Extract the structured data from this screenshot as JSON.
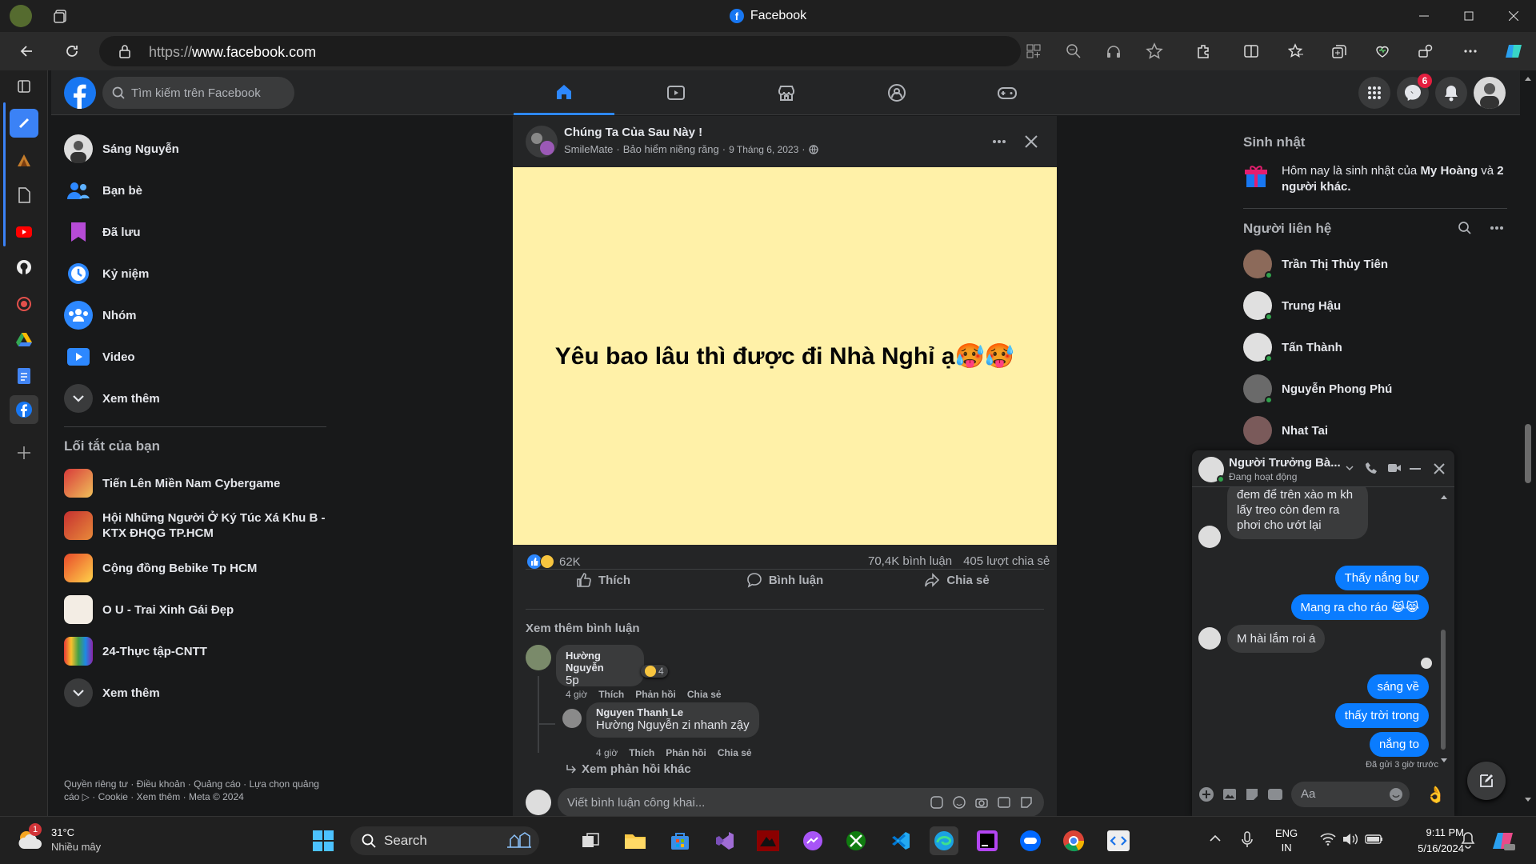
{
  "window": {
    "title": "Facebook"
  },
  "browser": {
    "url_scheme": "https://",
    "url_host": "www.facebook.com"
  },
  "fb": {
    "search_placeholder": "Tìm kiếm trên Facebook",
    "messenger_badge": "6"
  },
  "left_menu": {
    "items": [
      {
        "label": "Sáng Nguyễn",
        "icon": "avatar"
      },
      {
        "label": "Bạn bè",
        "icon": "friends-icon"
      },
      {
        "label": "Đã lưu",
        "icon": "bookmark-icon"
      },
      {
        "label": "Kỷ niệm",
        "icon": "clock-icon"
      },
      {
        "label": "Nhóm",
        "icon": "groups-icon"
      },
      {
        "label": "Video",
        "icon": "video-icon"
      },
      {
        "label": "Xem thêm",
        "icon": "chevron-down-icon"
      }
    ],
    "shortcuts_title": "Lối tắt của bạn",
    "shortcuts": [
      {
        "label": "Tiến Lên Miền Nam Cybergame"
      },
      {
        "label": "Hội Những Người Ở Ký Túc Xá Khu B - KTX ĐHQG TP.HCM"
      },
      {
        "label": "Cộng đồng Bebike Tp HCM"
      },
      {
        "label": "O U - Trai Xinh Gái Đẹp"
      },
      {
        "label": "24-Thực tập-CNTT"
      }
    ],
    "shortcuts_more": "Xem thêm",
    "footer": "Quyền riêng tư · Điều khoản · Quảng cáo · Lựa chọn quảng cáo ▷ · Cookie · Xem thêm · Meta © 2024"
  },
  "post": {
    "page_name": "Chúng Ta Của Sau Này !",
    "sub_author": "SmileMate",
    "sub_sponsor": "Bảo hiểm niềng răng",
    "date": "9 Tháng 6, 2023",
    "image_text": "Yêu bao lâu thì được đi Nhà Nghỉ ạ🥵🥵",
    "reactions_count": "62K",
    "comments_count": "70,4K bình luận",
    "shares_count": "405 lượt chia sẻ",
    "like_label": "Thích",
    "comment_label": "Bình luận",
    "share_label": "Chia sẻ",
    "more_comments": "Xem thêm bình luận",
    "comments": [
      {
        "author": "Hường Nguyễn",
        "text": "5p",
        "reaction_count": "4",
        "time": "4 giờ",
        "like": "Thích",
        "reply": "Phản hồi",
        "share": "Chia sẻ"
      },
      {
        "author": "Nguyen Thanh Le",
        "mention": "Hường Nguyễn",
        "text": " zi nhanh zậy",
        "time": "4 giờ",
        "like": "Thích",
        "reply": "Phản hồi",
        "share": "Chia sẻ"
      }
    ],
    "more_replies": "Xem phản hồi khác",
    "comment_placeholder": "Viết bình luận công khai..."
  },
  "right_panel": {
    "birthday_title": "Sinh nhật",
    "birthday_text_pre": "Hôm nay là sinh nhật của ",
    "birthday_name": "My Hoàng",
    "birthday_text_mid": " và ",
    "birthday_others": "2 người khác.",
    "contacts_title": "Người liên hệ",
    "contacts": [
      {
        "name": "Trần Thị Thủy Tiên"
      },
      {
        "name": "Trung Hậu"
      },
      {
        "name": "Tấn Thành"
      },
      {
        "name": "Nguyễn Phong Phú"
      },
      {
        "name": "Nhat Tai"
      }
    ]
  },
  "chat": {
    "name": "Người Trưởng Bà...",
    "status": "Đang hoạt động",
    "messages": [
      {
        "dir": "in",
        "text": "đem để trên xào m kh lấy treo còn đem ra phơi cho ướt lại"
      },
      {
        "dir": "out",
        "text": "Thấy nắng bự"
      },
      {
        "dir": "out",
        "text": "Mang ra cho ráo 😹😹"
      },
      {
        "dir": "in",
        "text": "M hài lắm roi á"
      },
      {
        "dir": "out",
        "text": "sáng về"
      },
      {
        "dir": "out",
        "text": "thấy trời trong"
      },
      {
        "dir": "out",
        "text": "nắng to"
      }
    ],
    "sent_status": "Đã gửi 3 giờ trước",
    "input_placeholder": "Aa"
  },
  "taskbar": {
    "weather_temp": "31°C",
    "weather_desc": "Nhiều mây",
    "weather_badge": "1",
    "search_label": "Search",
    "lang1": "ENG",
    "lang2": "IN",
    "time": "9:11 PM",
    "date": "5/16/2024"
  },
  "colors": {
    "fb_blue": "#2d88ff",
    "messenger_blue": "#0a7cff",
    "online": "#31a24c",
    "post_bg": "#fff1a8"
  }
}
